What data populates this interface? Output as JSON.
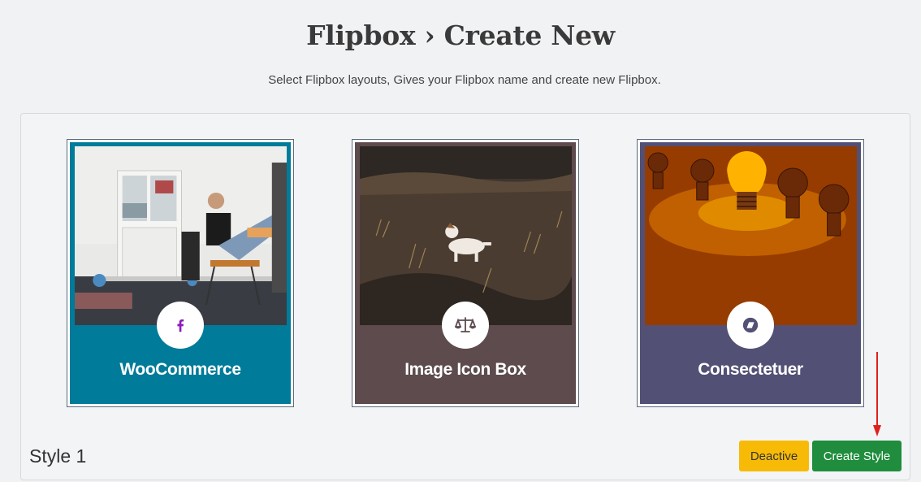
{
  "header": {
    "title": "Flipbox › Create New",
    "subtitle": "Select Flipbox layouts, Gives your Flipbox name and create new Flipbox."
  },
  "cards": [
    {
      "title": "WooCommerce",
      "icon": "facebook-icon",
      "bg_color": "#007b99",
      "border_color": "#1c5f7a",
      "icon_color": "#8a1bbd"
    },
    {
      "title": "Image Icon Box",
      "icon": "balance-scale-icon",
      "bg_color": "#5d4b4e",
      "border_color": "#4b3d40",
      "icon_color": "#5d4b4e"
    },
    {
      "title": "Consectetuer",
      "icon": "compass-icon",
      "bg_color": "#525075",
      "border_color": "#434066",
      "icon_color": "#525075"
    }
  ],
  "footer": {
    "style_label": "Style 1",
    "deactive_label": "Deactive",
    "create_label": "Create Style"
  },
  "colors": {
    "deactive_bg": "#f7bb07",
    "create_bg": "#1f8d3d",
    "arrow": "#e0201c"
  }
}
